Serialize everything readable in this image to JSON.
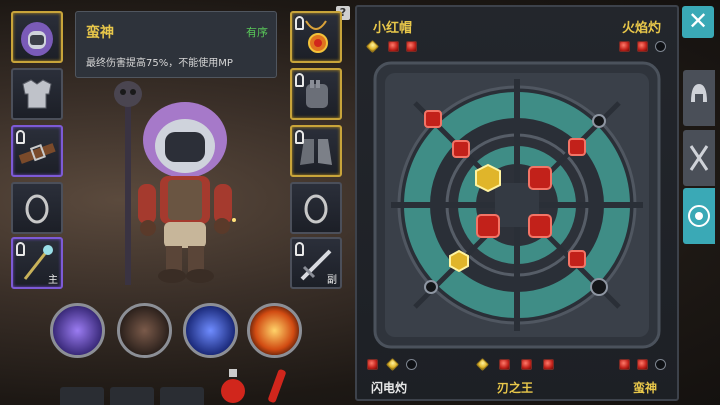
{
  "left_slots": [
    {
      "icon": "hood-helmet-icon",
      "border": "gold"
    },
    {
      "icon": "armor-icon",
      "border": "none"
    },
    {
      "icon": "belt-icon",
      "border": "purple",
      "locked": true
    },
    {
      "icon": "ring-icon",
      "border": "none"
    },
    {
      "icon": "staff-icon",
      "border": "purple",
      "locked": true,
      "tag": "主"
    }
  ],
  "right_slots": [
    {
      "icon": "amulet-icon",
      "border": "gold",
      "locked": true
    },
    {
      "icon": "gauntlet-icon",
      "border": "gold",
      "locked": true
    },
    {
      "icon": "boots-icon",
      "border": "gold",
      "locked": true
    },
    {
      "icon": "ring-icon",
      "border": "none"
    },
    {
      "icon": "sword-icon",
      "border": "none",
      "locked": true,
      "tag": "副"
    }
  ],
  "tooltip": {
    "name": "蛮神",
    "status": "有序",
    "desc": "最终伤害提高75%，不能使用MP"
  },
  "skills": [
    {
      "icon": "arcane-skill-icon"
    },
    {
      "icon": "claw-skill-icon"
    },
    {
      "icon": "lightning-orb-skill-icon"
    },
    {
      "icon": "fireball-skill-icon"
    }
  ],
  "board": {
    "top_left": {
      "name": "小红帽",
      "gems": [
        "gold",
        "red",
        "red"
      ]
    },
    "top_right": {
      "name": "火焰灼",
      "gems": [
        "red",
        "red",
        "empty"
      ]
    },
    "bottom_left": {
      "name": "闪电灼",
      "color": "#e8e8e8",
      "gems": [
        "red",
        "gold",
        "empty"
      ]
    },
    "bottom_center": {
      "name": "刃之王",
      "color": "#e8c74a",
      "gems": [
        "gold",
        "red",
        "red",
        "red"
      ]
    },
    "bottom_right": {
      "name": "蛮神",
      "color": "#e8c74a",
      "gems": [
        "red",
        "red",
        "empty"
      ]
    }
  },
  "colors": {
    "accent": "#3aa9b6",
    "gold_text": "#e8c74a",
    "green_text": "#59c759"
  },
  "close_label": "✕",
  "help_label": "?"
}
